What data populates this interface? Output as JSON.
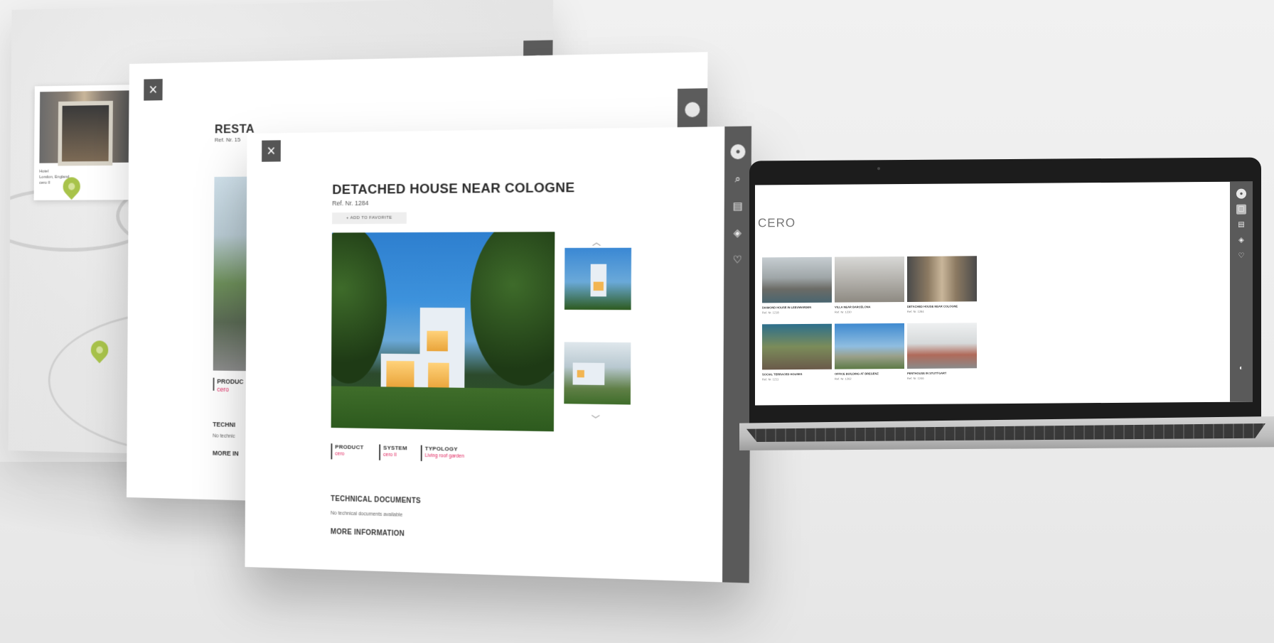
{
  "map_screen": {
    "card_title": "Hotel",
    "card_location": "London, England",
    "card_system": "cero II"
  },
  "middle_screen": {
    "title": "RESTA",
    "ref": "Ref. Nr. 15",
    "product_label": "PRODUC",
    "product_value": "cero",
    "tech_label": "TECHNI",
    "tech_text": "No technic",
    "more_label": "MORE IN"
  },
  "front_screen": {
    "title": "DETACHED HOUSE NEAR COLOGNE",
    "ref": "Ref. Nr. 1284",
    "favorite_button": "+ ADD TO FAVORITE",
    "attributes": [
      {
        "label": "PRODUCT",
        "value": "cero"
      },
      {
        "label": "SYSTEM",
        "value": "cero II"
      },
      {
        "label": "TYPOLOGY",
        "value": "Living roof garden"
      }
    ],
    "tech_title": "TECHNICAL DOCUMENTS",
    "tech_text": "No technical documents available",
    "more_title": "MORE INFORMATION",
    "sidebar_icons": [
      "user-icon",
      "search-icon",
      "building-icon",
      "cube-icon",
      "heart-icon"
    ]
  },
  "laptop_screen": {
    "brand": "CERO",
    "tiles": [
      {
        "caption": "DIAMOND HOUSE IN LEEUWARDEN",
        "ref": "Ref. Nr. 1218"
      },
      {
        "caption": "VILLA NEAR BARCELONA",
        "ref": "Ref. Nr. 1230"
      },
      {
        "caption": "DETACHED HOUSE NEAR COLOGNE",
        "ref": "Ref. Nr. 1284"
      },
      {
        "caption": "SOCIAL TERRACED HOUSES",
        "ref": "Ref. Nr. 1211"
      },
      {
        "caption": "OFFICE BUILDING AT BREGENZ",
        "ref": "Ref. Nr. 1262"
      },
      {
        "caption": "PENTHOUSE IN STUTTGART",
        "ref": "Ref. Nr. 1246"
      }
    ]
  },
  "colors": {
    "sidebar": "#5a5a5a",
    "accent_pink": "#e0245e",
    "pin_green": "#a8c34a"
  }
}
